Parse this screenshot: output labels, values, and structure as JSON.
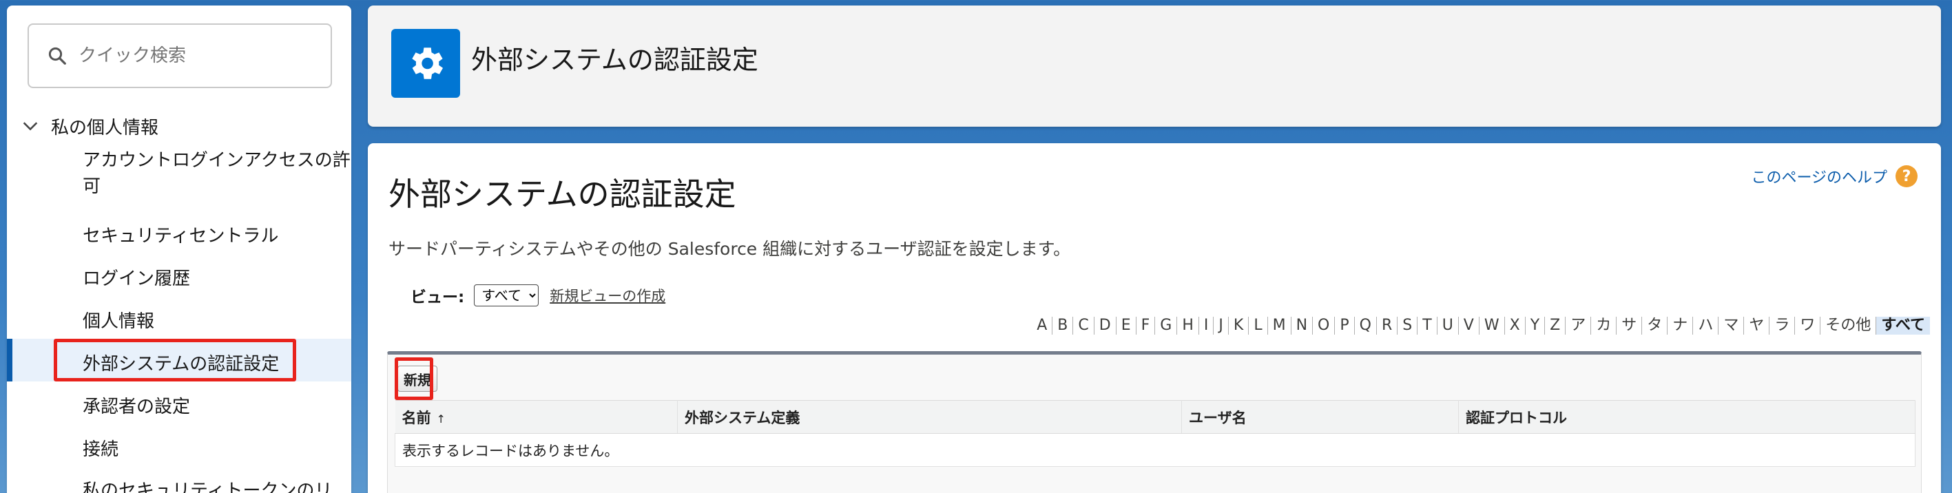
{
  "sidebar": {
    "search_placeholder": "クイック検索",
    "section_label": "私の個人情報",
    "items": [
      {
        "label": "アカウントログインアクセスの許可"
      },
      {
        "label": "セキュリティセントラル"
      },
      {
        "label": "ログイン履歴"
      },
      {
        "label": "個人情報"
      },
      {
        "label": "外部システムの認証設定",
        "active": true
      },
      {
        "label": "承認者の設定"
      },
      {
        "label": "接続"
      },
      {
        "label": "私のセキュリティトークンのリ"
      }
    ]
  },
  "header": {
    "title": "外部システムの認証設定",
    "icon": "gear-icon"
  },
  "main": {
    "page_title": "外部システムの認証設定",
    "help_label": "このページのヘルプ",
    "help_icon": "?",
    "description": "サードパーティシステムやその他の Salesforce 組織に対するユーザ認証を設定します。",
    "view_label": "ビュー:",
    "view_selected": "すべて",
    "new_view_link": "新規ビューの作成",
    "alpha_filter": [
      "A",
      "B",
      "C",
      "D",
      "E",
      "F",
      "G",
      "H",
      "I",
      "J",
      "K",
      "L",
      "M",
      "N",
      "O",
      "P",
      "Q",
      "R",
      "S",
      "T",
      "U",
      "V",
      "W",
      "X",
      "Y",
      "Z",
      "ア",
      "カ",
      "サ",
      "タ",
      "ナ",
      "ハ",
      "マ",
      "ヤ",
      "ラ",
      "ワ",
      "その他",
      "すべて"
    ],
    "alpha_selected": "すべて",
    "new_button": "新規",
    "table": {
      "columns": [
        "名前",
        "外部システム定義",
        "ユーザ名",
        "認証プロトコル"
      ],
      "sort_indicator": "↑",
      "empty_message": "表示するレコードはありません。"
    }
  },
  "colors": {
    "brand_blue": "#0176d3",
    "highlight_red": "#e8231c",
    "link_blue": "#0b5cab"
  }
}
